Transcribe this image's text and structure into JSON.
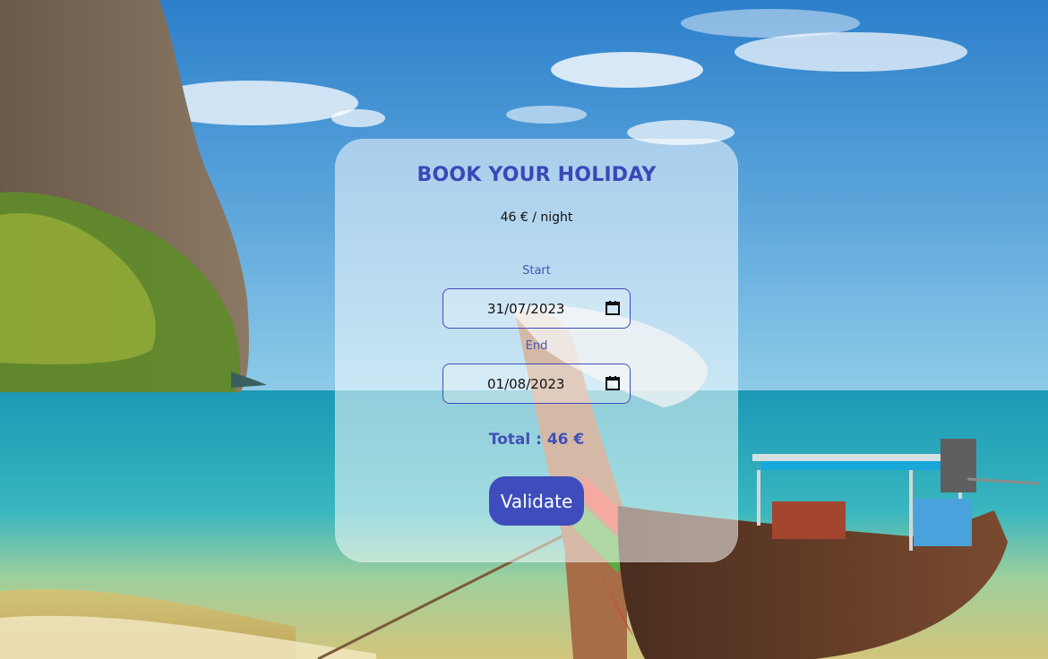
{
  "booking": {
    "title": "BOOK YOUR HOLIDAY",
    "price": "46 € / night",
    "start_label": "Start",
    "start_date": "31/07/2023",
    "end_label": "End",
    "end_date": "01/08/2023",
    "total": "Total : 46 €",
    "validate_label": "Validate"
  },
  "icons": {
    "calendar": "calendar-icon"
  },
  "colors": {
    "accent": "#3e4dbb",
    "title": "#3a48b8",
    "label": "#4a53b3"
  }
}
